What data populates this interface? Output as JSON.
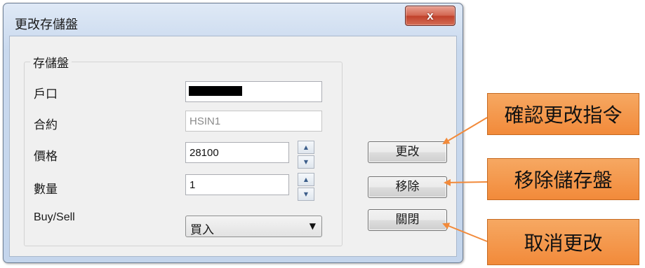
{
  "window": {
    "title": "更改存儲盤",
    "close_label": "x"
  },
  "group": {
    "title": "存儲盤"
  },
  "fields": {
    "account": {
      "label": "戶口"
    },
    "contract": {
      "label": "合約",
      "value": "HSIN1"
    },
    "price": {
      "label": "價格",
      "value": "28100"
    },
    "quantity": {
      "label": "數量",
      "value": "1"
    },
    "side": {
      "label": "Buy/Sell",
      "selected": "買入"
    }
  },
  "buttons": {
    "modify": "更改",
    "remove": "移除",
    "close": "關閉"
  },
  "callouts": {
    "confirm": "確認更改指令",
    "remove": "移除儲存盤",
    "cancel": "取消更改"
  },
  "colors": {
    "callout": "#f28a3a",
    "callout_border": "#c56a22"
  }
}
